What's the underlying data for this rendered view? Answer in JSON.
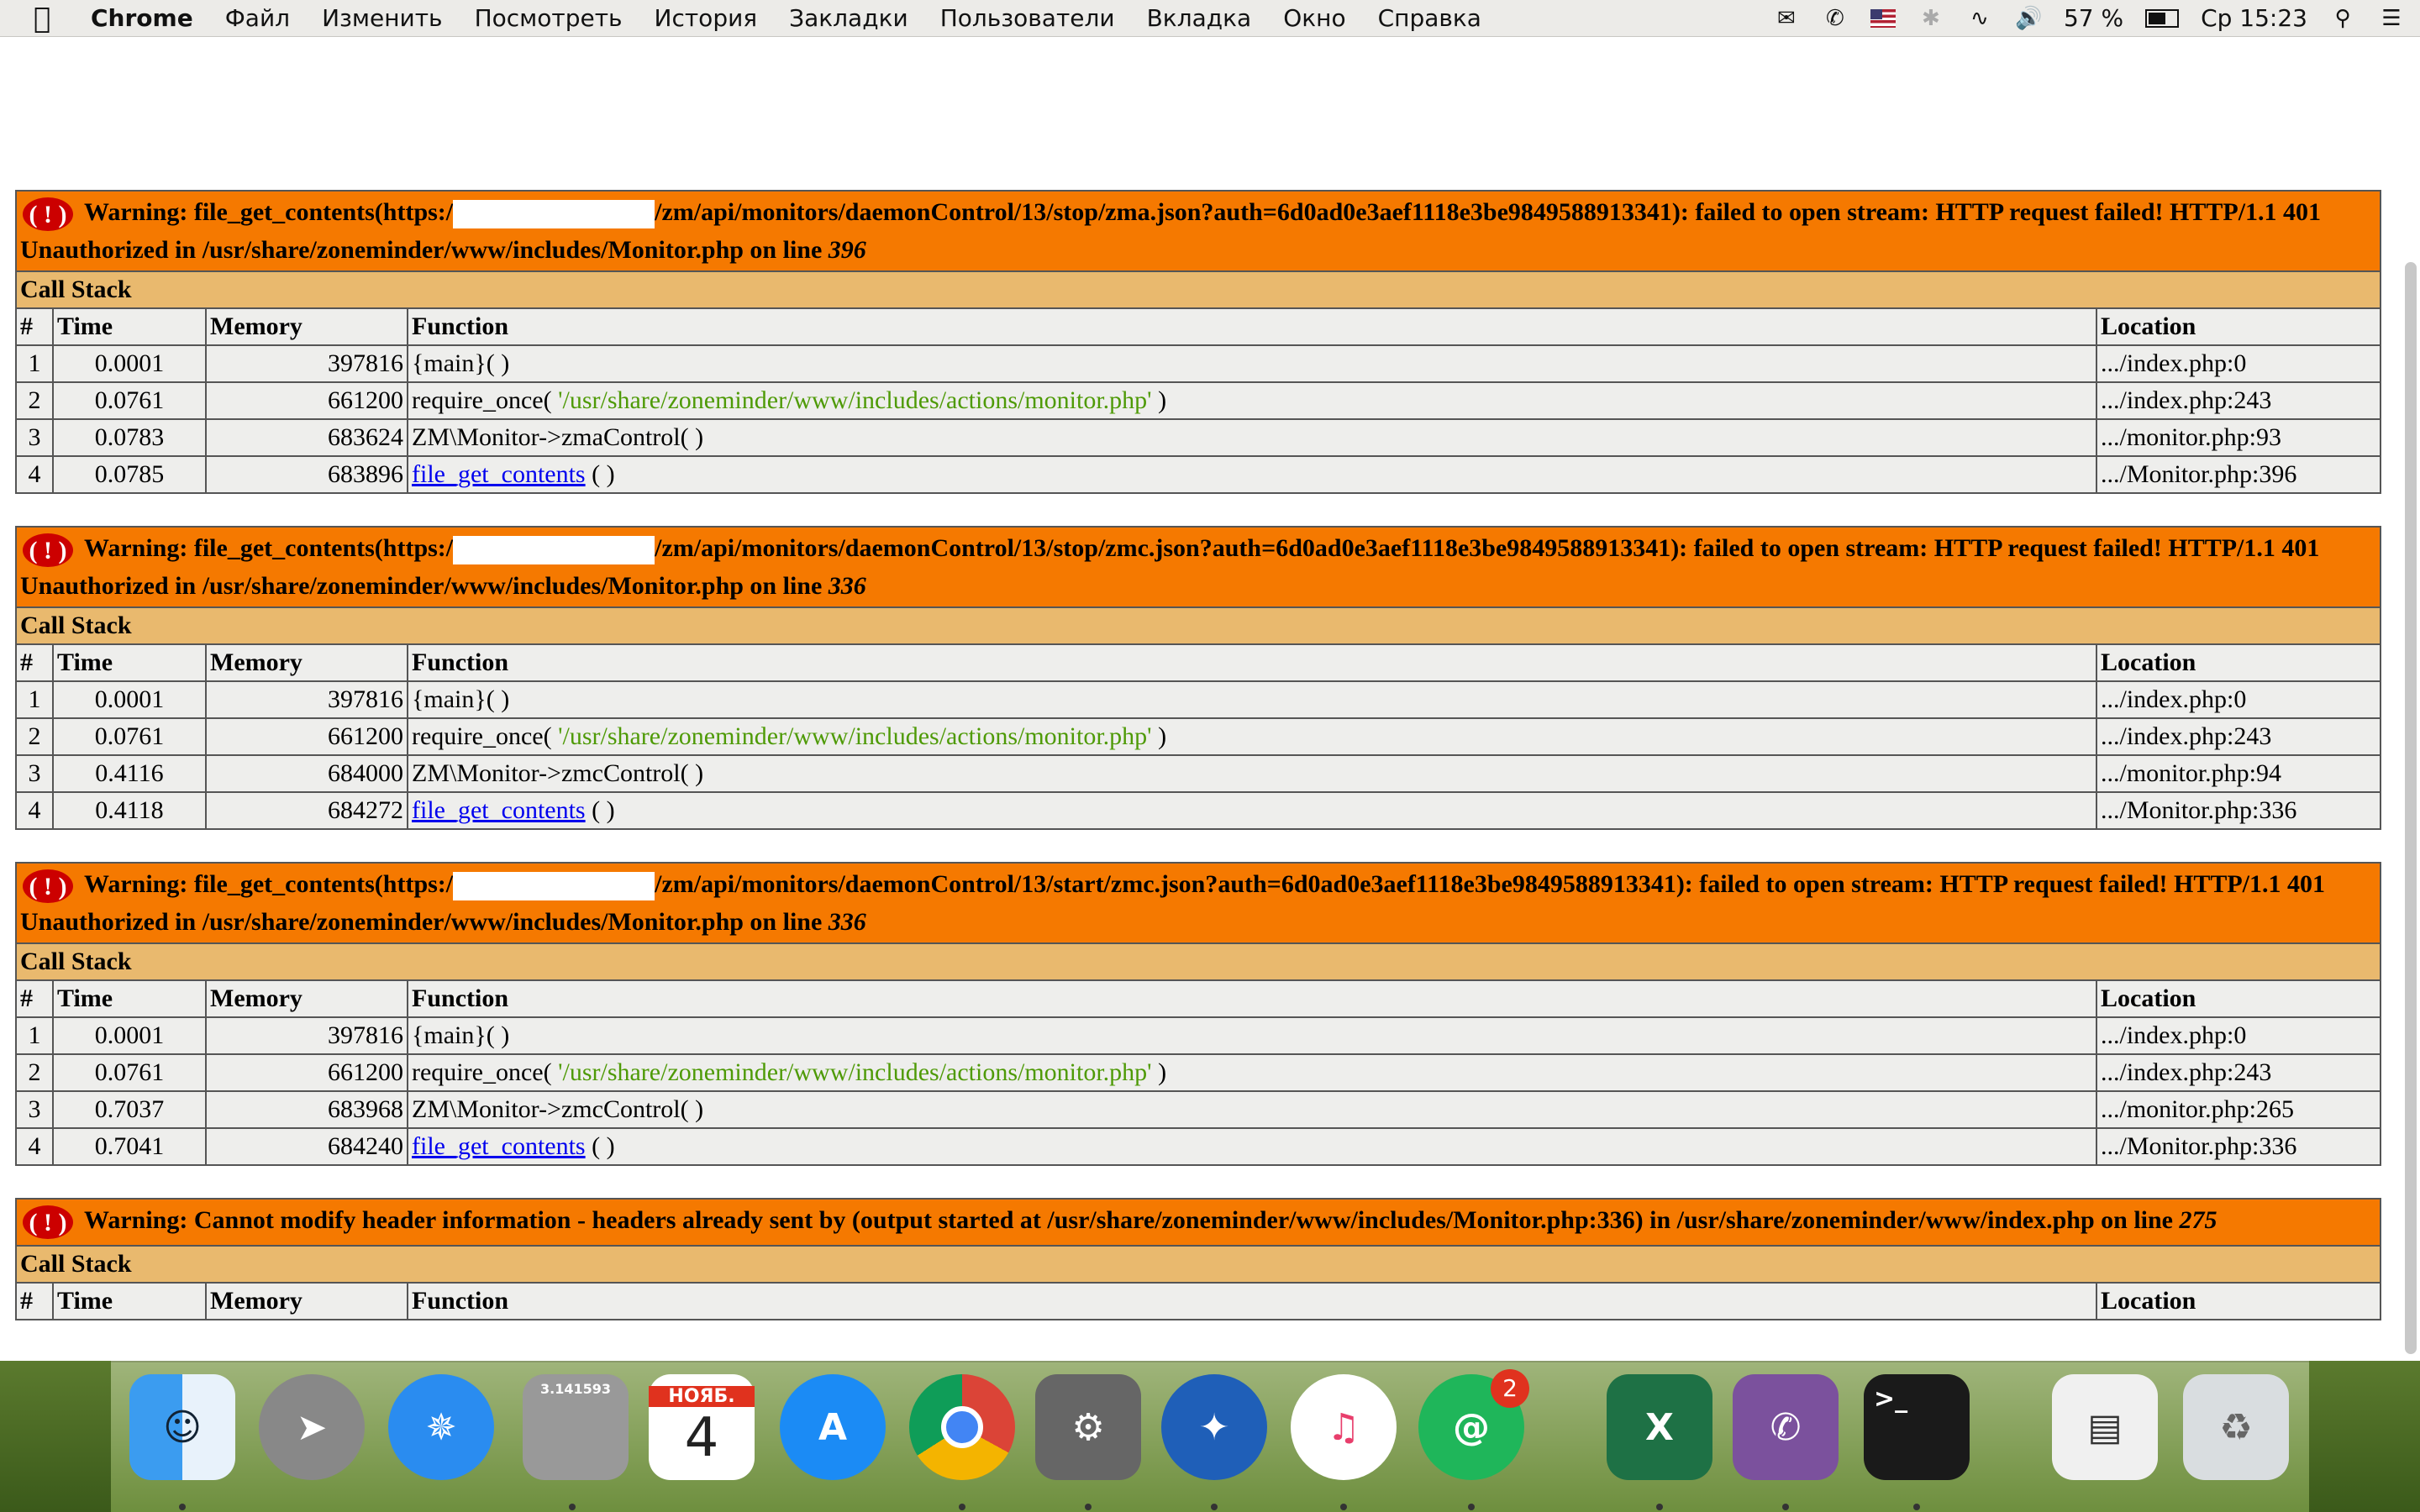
{
  "menubar": {
    "app_name": "Chrome",
    "items": [
      "Файл",
      "Изменить",
      "Посмотреть",
      "История",
      "Закладки",
      "Пользователи",
      "Вкладка",
      "Окно",
      "Справка"
    ],
    "battery": "57 %",
    "clock": "Ср 15:23"
  },
  "errors": [
    {
      "prefix": "Warning: file_get_contents(https:/",
      "suffix": "/zm/api/monitors/daemonControl/13/stop/zma.json?auth=6d0ad0e3aef1118e3be9849588913341): failed to open stream: HTTP request failed! HTTP/1.1 401 Unauthorized in /usr/share/zoneminder/www/includes/Monitor.php on line ",
      "line": "396",
      "rows": [
        {
          "n": "1",
          "time": "0.0001",
          "mem": "397816",
          "func": "{main}( )",
          "loc": ".../index.php:0"
        },
        {
          "n": "2",
          "time": "0.0761",
          "mem": "661200",
          "func": "require_once( ",
          "arg": "'/usr/share/zoneminder/www/includes/actions/monitor.php'",
          "close": " )",
          "loc": ".../index.php:243"
        },
        {
          "n": "3",
          "time": "0.0783",
          "mem": "683624",
          "func": "ZM\\Monitor->zmaControl( )",
          "loc": ".../monitor.php:93"
        },
        {
          "n": "4",
          "time": "0.0785",
          "mem": "683896",
          "link": "file_get_contents",
          "close": " ( )",
          "loc": ".../Monitor.php:396"
        }
      ]
    },
    {
      "prefix": "Warning: file_get_contents(https:/",
      "suffix": "/zm/api/monitors/daemonControl/13/stop/zmc.json?auth=6d0ad0e3aef1118e3be9849588913341): failed to open stream: HTTP request failed! HTTP/1.1 401 Unauthorized in /usr/share/zoneminder/www/includes/Monitor.php on line ",
      "line": "336",
      "rows": [
        {
          "n": "1",
          "time": "0.0001",
          "mem": "397816",
          "func": "{main}( )",
          "loc": ".../index.php:0"
        },
        {
          "n": "2",
          "time": "0.0761",
          "mem": "661200",
          "func": "require_once( ",
          "arg": "'/usr/share/zoneminder/www/includes/actions/monitor.php'",
          "close": " )",
          "loc": ".../index.php:243"
        },
        {
          "n": "3",
          "time": "0.4116",
          "mem": "684000",
          "func": "ZM\\Monitor->zmcControl( )",
          "loc": ".../monitor.php:94"
        },
        {
          "n": "4",
          "time": "0.4118",
          "mem": "684272",
          "link": "file_get_contents",
          "close": " ( )",
          "loc": ".../Monitor.php:336"
        }
      ]
    },
    {
      "prefix": "Warning: file_get_contents(https:/",
      "suffix": "/zm/api/monitors/daemonControl/13/start/zmc.json?auth=6d0ad0e3aef1118e3be9849588913341): failed to open stream: HTTP request failed! HTTP/1.1 401 Unauthorized in /usr/share/zoneminder/www/includes/Monitor.php on line ",
      "line": "336",
      "rows": [
        {
          "n": "1",
          "time": "0.0001",
          "mem": "397816",
          "func": "{main}( )",
          "loc": ".../index.php:0"
        },
        {
          "n": "2",
          "time": "0.0761",
          "mem": "661200",
          "func": "require_once( ",
          "arg": "'/usr/share/zoneminder/www/includes/actions/monitor.php'",
          "close": " )",
          "loc": ".../index.php:243"
        },
        {
          "n": "3",
          "time": "0.7037",
          "mem": "683968",
          "func": "ZM\\Monitor->zmcControl( )",
          "loc": ".../monitor.php:265"
        },
        {
          "n": "4",
          "time": "0.7041",
          "mem": "684240",
          "link": "file_get_contents",
          "close": " ( )",
          "loc": ".../Monitor.php:336"
        }
      ]
    }
  ],
  "last_error": {
    "text": "Warning: Cannot modify header information - headers already sent by (output started at /usr/share/zoneminder/www/includes/Monitor.php:336) in /usr/share/zoneminder/www/index.php on line ",
    "line": "275"
  },
  "table_labels": {
    "call_stack": "Call Stack",
    "hash": "#",
    "time": "Time",
    "memory": "Memory",
    "function": "Function",
    "location": "Location",
    "bang": "( ! )"
  },
  "dock": {
    "calendar_month": "НОЯБ.",
    "calendar_day": "4",
    "mail_badge": "2",
    "terminal_prompt": ">_",
    "calculator_display": "3.141593"
  }
}
